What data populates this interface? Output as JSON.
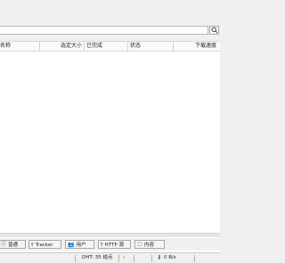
{
  "search": {
    "value": "",
    "placeholder": ""
  },
  "columns": [
    {
      "label": "名称"
    },
    {
      "label": "选定大小"
    },
    {
      "label": "已完成"
    },
    {
      "label": "状态"
    },
    {
      "label": "下载速度"
    }
  ],
  "tabs": [
    {
      "label": "普通",
      "icon": "info-icon"
    },
    {
      "label": "Tracker",
      "icon": "tracker-icon"
    },
    {
      "label": "用户",
      "icon": "users-icon"
    },
    {
      "label": "HTTP 源",
      "icon": "http-source-icon"
    },
    {
      "label": "内容",
      "icon": "folder-icon"
    }
  ],
  "status": {
    "dht": "DHT: 35 结点",
    "download_speed": "0 B/s"
  },
  "colors": {
    "panel": "#f0f0f0",
    "list_bg": "#ffffff",
    "download_arrow": "#2e9a2e",
    "bolt": "#e8a020"
  }
}
